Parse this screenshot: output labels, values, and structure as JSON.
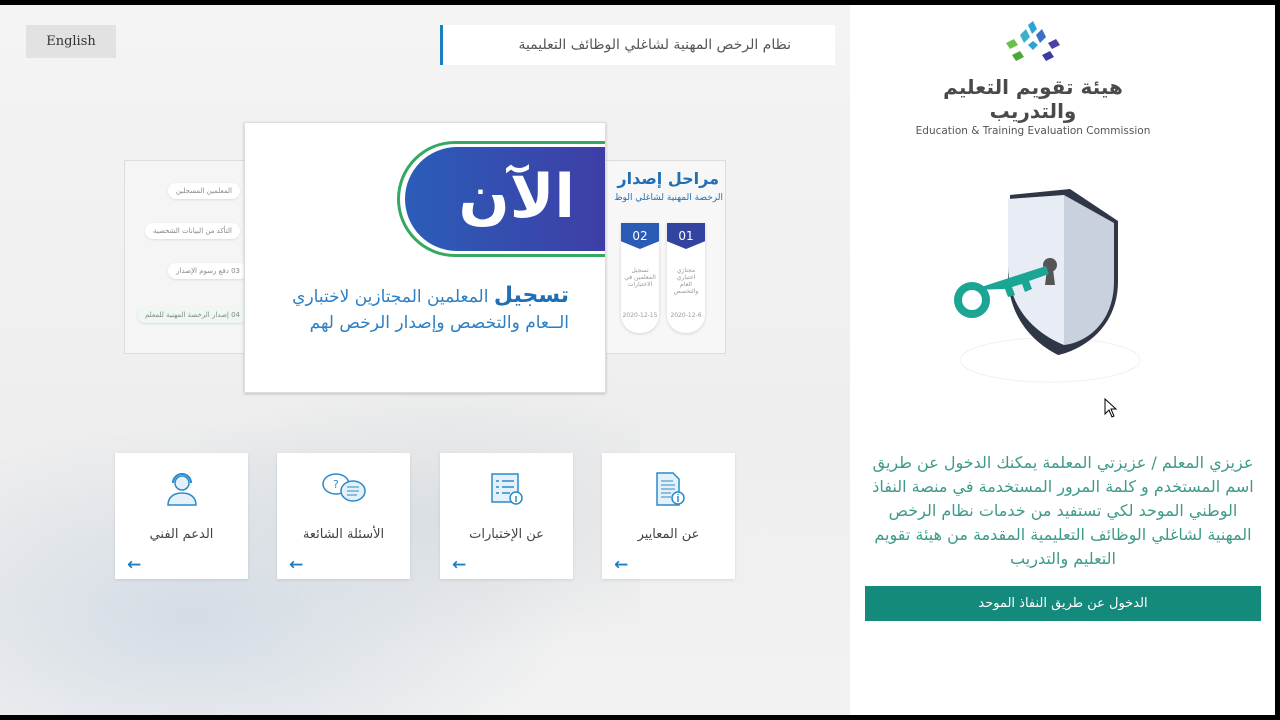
{
  "header": {
    "language_button": "English",
    "system_title": "نظام الرخص المهنية لشاغلي الوظائف التعليمية"
  },
  "carousel": {
    "main_slide": {
      "badge": "الآن",
      "line1_bold": "تسجيل",
      "line1": "المعلمين المجتازين لاختباري",
      "line2": "الــعام والتخصص وإصدار الرخص لهم"
    },
    "left_slide": {
      "stages": [
        "المعلمين المسجلين",
        "التأكد من البيانات الشخصية",
        "03 دفع رسوم الإصدار",
        "04 إصدار الرخصة المهنية للمعلم"
      ]
    },
    "right_slide": {
      "title": "مراحل إصدار",
      "subtitle": "الرخصة المهنية لشاغلي الوظ",
      "steps": [
        {
          "num": "01",
          "text": "مجتازي اختباري العام والتخصص",
          "date": "2020-12-6"
        },
        {
          "num": "02",
          "text": "تسجيل المعلمين في الاختبارات",
          "date": "2020-12-15"
        }
      ]
    }
  },
  "tiles": [
    {
      "label": "عن المعايير",
      "icon": "document-info-icon"
    },
    {
      "label": "عن الإختبارات",
      "icon": "checklist-info-icon"
    },
    {
      "label": "الأسئلة الشائعة",
      "icon": "chat-question-icon"
    },
    {
      "label": "الدعم الفني",
      "icon": "headset-support-icon"
    }
  ],
  "sidebar": {
    "logo_ar": "هيئة تقويم التعليم والتدريب",
    "logo_en": "Education & Training Evaluation Commission",
    "message": "عزيزي المعلم / عزيزتي المعلمة يمكنك الدخول عن طريق اسم المستخدم و كلمة المرور المستخدمة في منصة النفاذ الوطني الموحد لكي تستفيد من خدمات نظام الرخص المهنية لشاغلي الوظائف التعليمية المقدمة من هيئة تقويم التعليم والتدريب",
    "login_button": "الدخول عن طريق النفاذ الموحد"
  },
  "colors": {
    "accent": "#138a7c",
    "blue": "#1f7fc2",
    "message_text": "#3e9a8a"
  }
}
